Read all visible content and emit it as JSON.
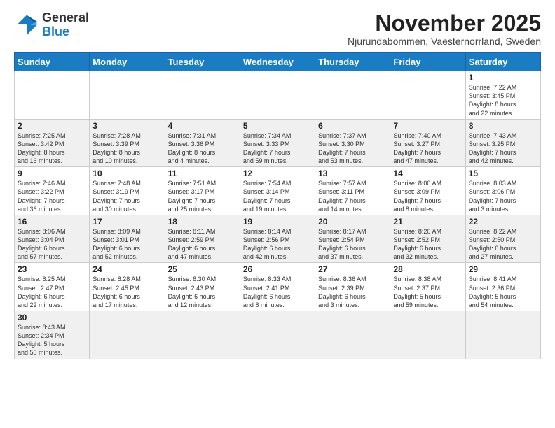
{
  "header": {
    "logo_general": "General",
    "logo_blue": "Blue",
    "month_title": "November 2025",
    "subtitle": "Njurundabommen, Vaesternorrland, Sweden"
  },
  "weekdays": [
    "Sunday",
    "Monday",
    "Tuesday",
    "Wednesday",
    "Thursday",
    "Friday",
    "Saturday"
  ],
  "weeks": [
    [
      {
        "day": "",
        "info": ""
      },
      {
        "day": "",
        "info": ""
      },
      {
        "day": "",
        "info": ""
      },
      {
        "day": "",
        "info": ""
      },
      {
        "day": "",
        "info": ""
      },
      {
        "day": "",
        "info": ""
      },
      {
        "day": "1",
        "info": "Sunrise: 7:22 AM\nSunset: 3:45 PM\nDaylight: 8 hours\nand 22 minutes."
      }
    ],
    [
      {
        "day": "2",
        "info": "Sunrise: 7:25 AM\nSunset: 3:42 PM\nDaylight: 8 hours\nand 16 minutes."
      },
      {
        "day": "3",
        "info": "Sunrise: 7:28 AM\nSunset: 3:39 PM\nDaylight: 8 hours\nand 10 minutes."
      },
      {
        "day": "4",
        "info": "Sunrise: 7:31 AM\nSunset: 3:36 PM\nDaylight: 8 hours\nand 4 minutes."
      },
      {
        "day": "5",
        "info": "Sunrise: 7:34 AM\nSunset: 3:33 PM\nDaylight: 7 hours\nand 59 minutes."
      },
      {
        "day": "6",
        "info": "Sunrise: 7:37 AM\nSunset: 3:30 PM\nDaylight: 7 hours\nand 53 minutes."
      },
      {
        "day": "7",
        "info": "Sunrise: 7:40 AM\nSunset: 3:27 PM\nDaylight: 7 hours\nand 47 minutes."
      },
      {
        "day": "8",
        "info": "Sunrise: 7:43 AM\nSunset: 3:25 PM\nDaylight: 7 hours\nand 42 minutes."
      }
    ],
    [
      {
        "day": "9",
        "info": "Sunrise: 7:46 AM\nSunset: 3:22 PM\nDaylight: 7 hours\nand 36 minutes."
      },
      {
        "day": "10",
        "info": "Sunrise: 7:48 AM\nSunset: 3:19 PM\nDaylight: 7 hours\nand 30 minutes."
      },
      {
        "day": "11",
        "info": "Sunrise: 7:51 AM\nSunset: 3:17 PM\nDaylight: 7 hours\nand 25 minutes."
      },
      {
        "day": "12",
        "info": "Sunrise: 7:54 AM\nSunset: 3:14 PM\nDaylight: 7 hours\nand 19 minutes."
      },
      {
        "day": "13",
        "info": "Sunrise: 7:57 AM\nSunset: 3:11 PM\nDaylight: 7 hours\nand 14 minutes."
      },
      {
        "day": "14",
        "info": "Sunrise: 8:00 AM\nSunset: 3:09 PM\nDaylight: 7 hours\nand 8 minutes."
      },
      {
        "day": "15",
        "info": "Sunrise: 8:03 AM\nSunset: 3:06 PM\nDaylight: 7 hours\nand 3 minutes."
      }
    ],
    [
      {
        "day": "16",
        "info": "Sunrise: 8:06 AM\nSunset: 3:04 PM\nDaylight: 6 hours\nand 57 minutes."
      },
      {
        "day": "17",
        "info": "Sunrise: 8:09 AM\nSunset: 3:01 PM\nDaylight: 6 hours\nand 52 minutes."
      },
      {
        "day": "18",
        "info": "Sunrise: 8:11 AM\nSunset: 2:59 PM\nDaylight: 6 hours\nand 47 minutes."
      },
      {
        "day": "19",
        "info": "Sunrise: 8:14 AM\nSunset: 2:56 PM\nDaylight: 6 hours\nand 42 minutes."
      },
      {
        "day": "20",
        "info": "Sunrise: 8:17 AM\nSunset: 2:54 PM\nDaylight: 6 hours\nand 37 minutes."
      },
      {
        "day": "21",
        "info": "Sunrise: 8:20 AM\nSunset: 2:52 PM\nDaylight: 6 hours\nand 32 minutes."
      },
      {
        "day": "22",
        "info": "Sunrise: 8:22 AM\nSunset: 2:50 PM\nDaylight: 6 hours\nand 27 minutes."
      }
    ],
    [
      {
        "day": "23",
        "info": "Sunrise: 8:25 AM\nSunset: 2:47 PM\nDaylight: 6 hours\nand 22 minutes."
      },
      {
        "day": "24",
        "info": "Sunrise: 8:28 AM\nSunset: 2:45 PM\nDaylight: 6 hours\nand 17 minutes."
      },
      {
        "day": "25",
        "info": "Sunrise: 8:30 AM\nSunset: 2:43 PM\nDaylight: 6 hours\nand 12 minutes."
      },
      {
        "day": "26",
        "info": "Sunrise: 8:33 AM\nSunset: 2:41 PM\nDaylight: 6 hours\nand 8 minutes."
      },
      {
        "day": "27",
        "info": "Sunrise: 8:36 AM\nSunset: 2:39 PM\nDaylight: 6 hours\nand 3 minutes."
      },
      {
        "day": "28",
        "info": "Sunrise: 8:38 AM\nSunset: 2:37 PM\nDaylight: 5 hours\nand 59 minutes."
      },
      {
        "day": "29",
        "info": "Sunrise: 8:41 AM\nSunset: 2:36 PM\nDaylight: 5 hours\nand 54 minutes."
      }
    ],
    [
      {
        "day": "30",
        "info": "Sunrise: 8:43 AM\nSunset: 2:34 PM\nDaylight: 5 hours\nand 50 minutes."
      },
      {
        "day": "",
        "info": ""
      },
      {
        "day": "",
        "info": ""
      },
      {
        "day": "",
        "info": ""
      },
      {
        "day": "",
        "info": ""
      },
      {
        "day": "",
        "info": ""
      },
      {
        "day": "",
        "info": ""
      }
    ]
  ]
}
